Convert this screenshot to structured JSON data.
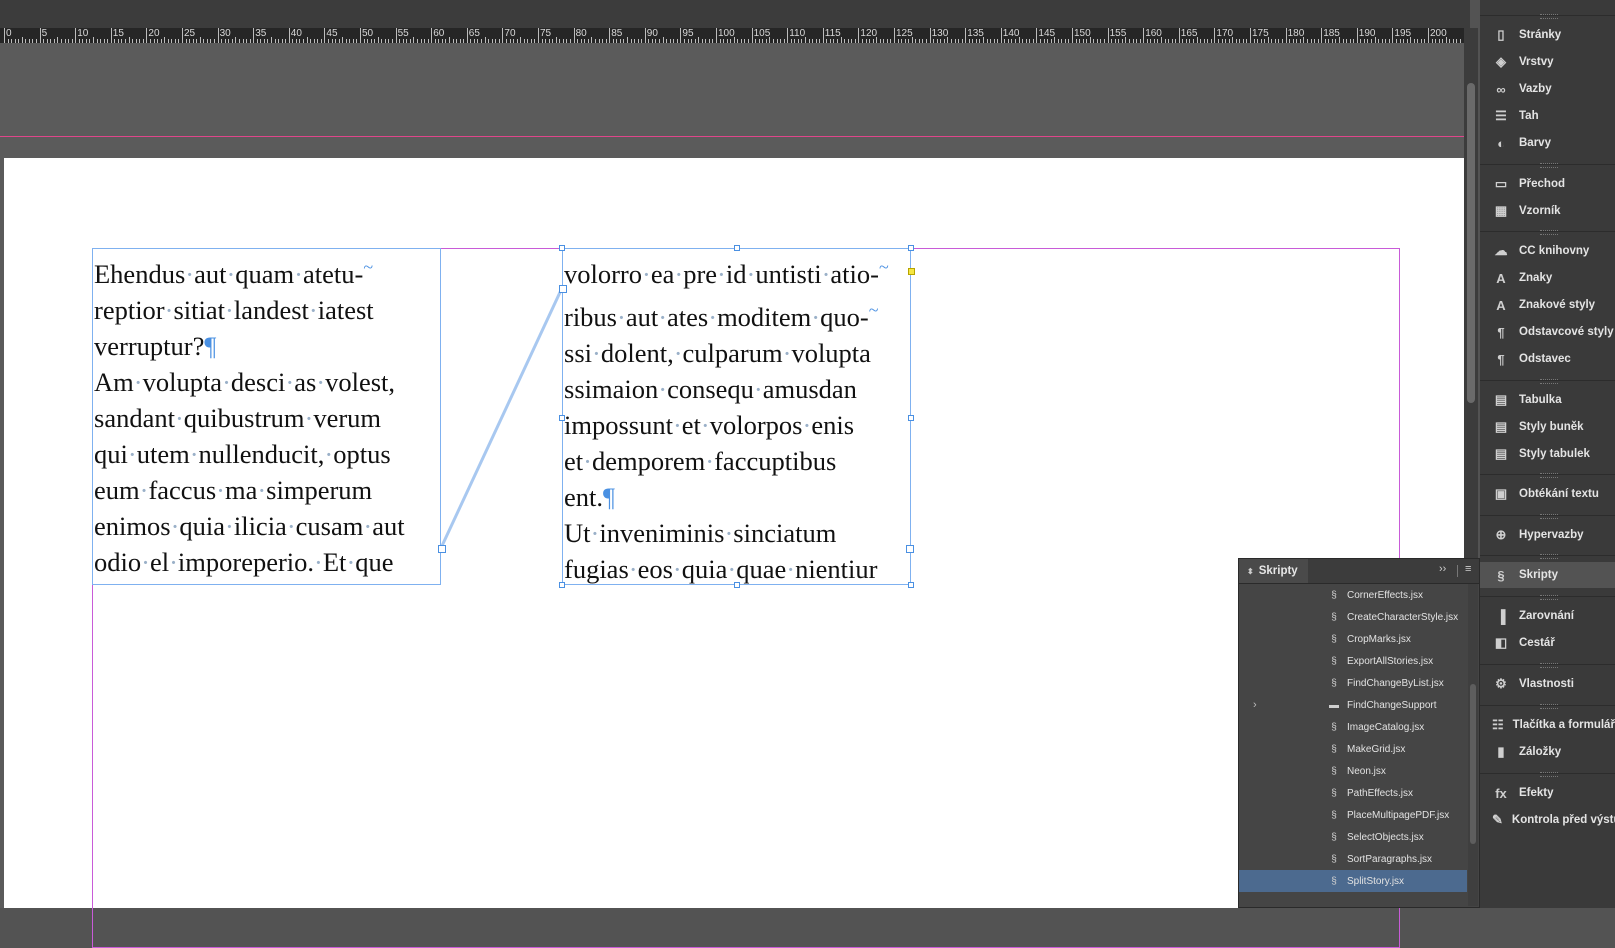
{
  "ruler": {
    "labels": [
      "0",
      "5",
      "10",
      "15",
      "20",
      "25",
      "30",
      "35",
      "40",
      "45",
      "50",
      "55",
      "60",
      "65",
      "70",
      "75",
      "80",
      "85",
      "90",
      "95",
      "100",
      "105",
      "110",
      "115",
      "120",
      "125",
      "130",
      "135",
      "140",
      "145",
      "150",
      "155",
      "160",
      "165",
      "170",
      "175",
      "180",
      "185",
      "190",
      "195",
      "200",
      "20"
    ]
  },
  "document": {
    "frame1_lines": [
      "Ehendus aut quam atetu-",
      "reptior sitiat landest iatest",
      "verruptur?",
      "Am volupta desci as volest,",
      "sandant quibustrum verum",
      "qui utem nullenducit, optus",
      "eum faccus ma simperum",
      "enimos quia ilicia cusam aut",
      "odio el imporeperio. Et que"
    ],
    "frame2_lines": [
      "volorro ea pre id untisti atio-",
      "ribus aut ates moditem quo-",
      "ssi dolent, culparum volupta",
      "ssimaion consequ amusdan",
      "impossunt et volorpos enis",
      "et demporem faccuptibus",
      "ent.",
      "Ut inveniminis sinciatum",
      "fugias eos quia quae nientiur"
    ],
    "pilcrow": "¶",
    "tilde": "~"
  },
  "dock": {
    "items": [
      {
        "label": "Stránky",
        "icon": "pages-icon"
      },
      {
        "label": "Vrstvy",
        "icon": "layers-icon"
      },
      {
        "label": "Vazby",
        "icon": "links-icon"
      },
      {
        "label": "Tah",
        "icon": "stroke-icon"
      },
      {
        "label": "Barvy",
        "icon": "swatches-icon"
      },
      {
        "label": "Přechod",
        "icon": "gradient-icon"
      },
      {
        "label": "Vzorník",
        "icon": "swatch-book-icon"
      },
      {
        "label": "CC knihovny",
        "icon": "cc-libraries-icon"
      },
      {
        "label": "Znaky",
        "icon": "character-icon"
      },
      {
        "label": "Znakové styly",
        "icon": "character-styles-icon"
      },
      {
        "label": "Odstavcové styly",
        "icon": "paragraph-styles-icon"
      },
      {
        "label": "Odstavec",
        "icon": "paragraph-icon"
      },
      {
        "label": "Tabulka",
        "icon": "table-icon"
      },
      {
        "label": "Styly buněk",
        "icon": "cell-styles-icon"
      },
      {
        "label": "Styly tabulek",
        "icon": "table-styles-icon"
      },
      {
        "label": "Obtékání textu",
        "icon": "text-wrap-icon"
      },
      {
        "label": "Hypervazby",
        "icon": "hyperlinks-icon"
      },
      {
        "label": "Skripty",
        "icon": "scripts-icon"
      },
      {
        "label": "Zarovnání",
        "icon": "align-icon"
      },
      {
        "label": "Cestář",
        "icon": "pathfinder-icon"
      },
      {
        "label": "Vlastnosti",
        "icon": "properties-icon"
      },
      {
        "label": "Tlačítka a formuláře",
        "icon": "buttons-forms-icon"
      },
      {
        "label": "Záložky",
        "icon": "bookmarks-icon"
      },
      {
        "label": "Efekty",
        "icon": "effects-icon"
      },
      {
        "label": "Kontrola před výstupem",
        "icon": "preflight-icon"
      }
    ]
  },
  "scripts_panel": {
    "title": "Skripty",
    "expand": "››",
    "menu": "≡",
    "items": [
      "CornerEffects.jsx",
      "CreateCharacterStyle.jsx",
      "CropMarks.jsx",
      "ExportAllStories.jsx",
      "FindChangeByList.jsx",
      "FindChangeSupport",
      "ImageCatalog.jsx",
      "MakeGrid.jsx",
      "Neon.jsx",
      "PathEffects.jsx",
      "PlaceMultipagePDF.jsx",
      "SelectObjects.jsx",
      "SortParagraphs.jsx",
      "SplitStory.jsx"
    ],
    "selected": "SplitStory.jsx"
  },
  "colors": {
    "selection": "#4a90e2",
    "margin_guide": "#c85bd8",
    "bleed_guide": "#e0468b"
  }
}
